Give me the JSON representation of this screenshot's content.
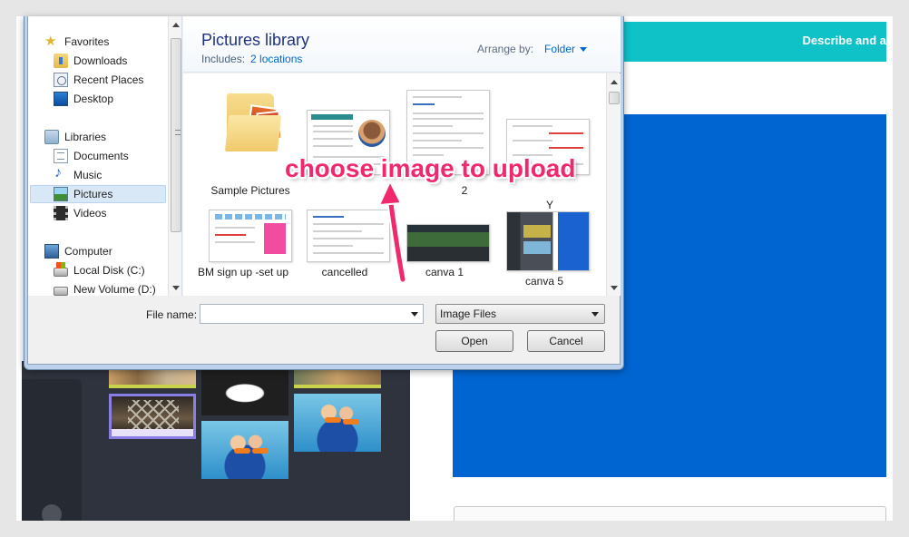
{
  "background_app": {
    "header_text": "Describe and a"
  },
  "dialog": {
    "nav": {
      "items": [
        {
          "label": "Favorites",
          "icon": "star-icon"
        },
        {
          "label": "Downloads",
          "icon": "downloads-folder-icon"
        },
        {
          "label": "Recent Places",
          "icon": "recent-places-icon"
        },
        {
          "label": "Desktop",
          "icon": "desktop-icon"
        },
        {
          "label": "Libraries",
          "icon": "libraries-icon"
        },
        {
          "label": "Documents",
          "icon": "documents-icon"
        },
        {
          "label": "Music",
          "icon": "music-icon"
        },
        {
          "label": "Pictures",
          "icon": "pictures-icon"
        },
        {
          "label": "Videos",
          "icon": "videos-icon"
        },
        {
          "label": "Computer",
          "icon": "computer-icon"
        },
        {
          "label": "Local Disk (C:)",
          "icon": "local-disk-icon"
        },
        {
          "label": "New Volume (D:)",
          "icon": "drive-icon"
        }
      ],
      "selected": "Pictures"
    },
    "library": {
      "title": "Pictures library",
      "includes_label": "Includes:",
      "includes_link": "2 locations",
      "arrange_label": "Arrange by:",
      "arrange_value": "Folder"
    },
    "files": [
      {
        "label": "Sample Pictures",
        "type": "folder"
      },
      {
        "label": "",
        "type": "image"
      },
      {
        "label": "2",
        "type": "image"
      },
      {
        "label": "Y",
        "type": "image"
      },
      {
        "label": "BM sign up -set up",
        "type": "image"
      },
      {
        "label": "cancelled",
        "type": "image"
      },
      {
        "label": "canva 1",
        "type": "image"
      },
      {
        "label": "canva 5",
        "type": "image"
      }
    ],
    "filename_label": "File name:",
    "filename_value": "",
    "filetype_value": "Image Files",
    "open_label": "Open",
    "cancel_label": "Cancel"
  },
  "annotation": {
    "text": "choose image to upload",
    "color": "#f0286e"
  },
  "colors": {
    "canva_teal": "#0fc2c8",
    "canvas_blue": "#0065d1",
    "library_title": "#1e3287",
    "link_blue": "#0066cc"
  }
}
